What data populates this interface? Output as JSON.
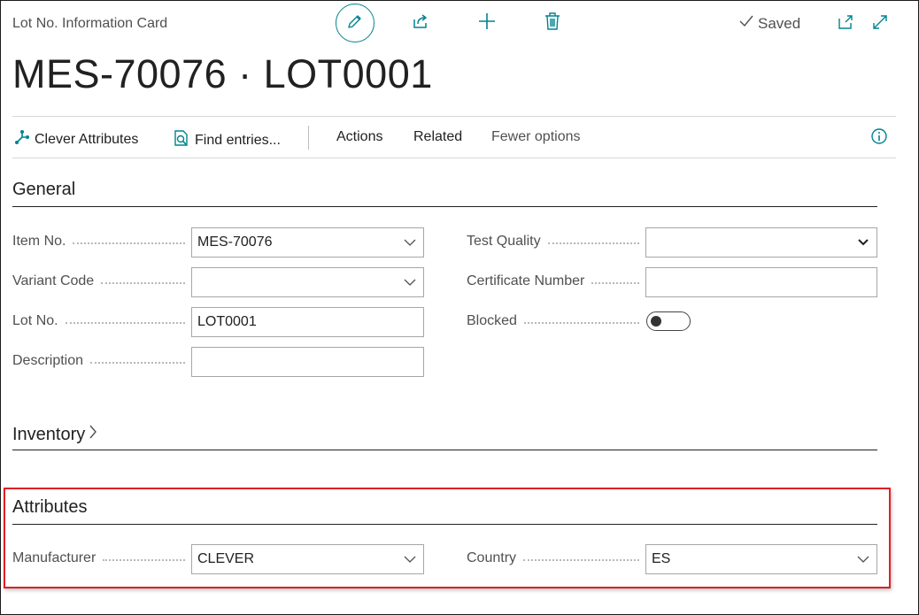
{
  "header": {
    "page_type": "Lot No. Information Card",
    "title": "MES-70076 · LOT0001",
    "saved_label": "Saved"
  },
  "toolbar": {
    "clever_attributes": "Clever Attributes",
    "find_entries": "Find entries...",
    "actions": "Actions",
    "related": "Related",
    "fewer_options": "Fewer options"
  },
  "general": {
    "heading": "General",
    "item_no": {
      "label": "Item No.",
      "value": "MES-70076"
    },
    "variant_code": {
      "label": "Variant Code",
      "value": ""
    },
    "lot_no": {
      "label": "Lot No.",
      "value": "LOT0001"
    },
    "description": {
      "label": "Description",
      "value": ""
    },
    "test_quality": {
      "label": "Test Quality",
      "value": ""
    },
    "certificate_number": {
      "label": "Certificate Number",
      "value": ""
    },
    "blocked": {
      "label": "Blocked",
      "value": false
    }
  },
  "inventory": {
    "heading": "Inventory"
  },
  "attributes": {
    "heading": "Attributes",
    "manufacturer": {
      "label": "Manufacturer",
      "value": "CLEVER"
    },
    "country": {
      "label": "Country",
      "value": "ES"
    }
  },
  "colors": {
    "accent": "#00838f",
    "highlight_border": "#e01f26"
  },
  "icons": [
    "edit-icon",
    "share-icon",
    "add-icon",
    "delete-icon",
    "check-icon",
    "open-new-window-icon",
    "expand-icon",
    "clever-attributes-icon",
    "find-entries-icon",
    "info-icon",
    "chevron-down-icon",
    "chevron-right-icon"
  ]
}
